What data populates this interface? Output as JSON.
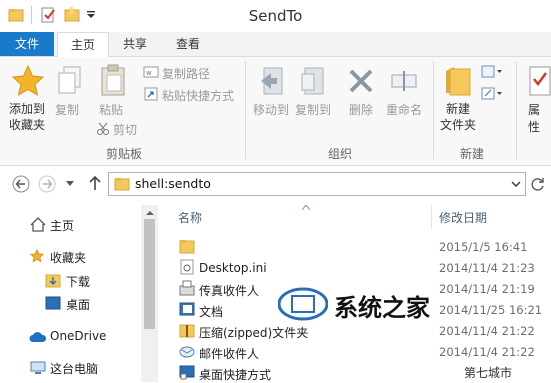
{
  "window": {
    "title": "SendTo"
  },
  "tabs": [
    {
      "label": "文件"
    },
    {
      "label": "主页"
    },
    {
      "label": "共享"
    },
    {
      "label": "查看"
    }
  ],
  "ribbon": {
    "clipboard": {
      "pin": "添加到",
      "pin2": "收藏夹",
      "copy": "复制",
      "paste": "粘贴",
      "copy_path": "复制路径",
      "paste_shortcut": "粘贴快捷方式",
      "cut": "剪切",
      "group": "剪贴板"
    },
    "organize": {
      "move_to": "移动到",
      "copy_to": "复制到",
      "delete": "删除",
      "rename": "重命名",
      "group": "组织"
    },
    "new": {
      "new_folder": "新建",
      "new_folder2": "文件夹",
      "group": "新建"
    },
    "open": {
      "properties": "属性"
    }
  },
  "address": {
    "path": "shell:sendto"
  },
  "nav": {
    "home": "主页",
    "favorites": "收藏夹",
    "downloads": "下载",
    "desktop": "桌面",
    "onedrive": "OneDrive",
    "thispc": "这台电脑"
  },
  "files": {
    "col_name": "名称",
    "col_date": "修改日期",
    "rows": [
      {
        "name": "",
        "date": "2015/1/5 16:41",
        "icon": "folder-icon"
      },
      {
        "name": "Desktop.ini",
        "date": "2014/11/4 21:23",
        "icon": "settings-file-icon"
      },
      {
        "name": "传真收件人",
        "date": "2014/11/4 21:19",
        "icon": "fax-icon"
      },
      {
        "name": "文档",
        "date": "2014/11/25 16:21",
        "icon": "document-icon"
      },
      {
        "name": "压缩(zipped)文件夹",
        "date": "2014/11/4 21:22",
        "icon": "zip-folder-icon"
      },
      {
        "name": "邮件收件人",
        "date": "2014/11/4 21:22",
        "icon": "mail-icon"
      },
      {
        "name": "桌面快捷方式",
        "date": "",
        "icon": "desktop-shortcut-icon"
      }
    ]
  },
  "watermark": {
    "text": "系统之家",
    "corner": "第七城市"
  },
  "colors": {
    "file_tab": "#1979ca",
    "folder": "#f4c85a",
    "accent": "#2a6fb5"
  }
}
